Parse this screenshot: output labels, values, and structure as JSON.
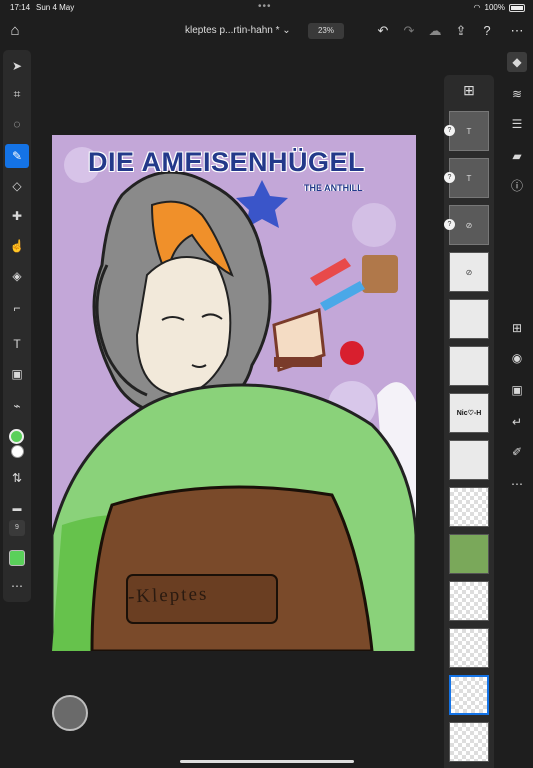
{
  "status": {
    "time": "17:14",
    "date": "Sun 4 May",
    "battery": "100%"
  },
  "header": {
    "title": "kleptes p...rtin-hahn *",
    "zoom": "23%",
    "icons": [
      "home-icon",
      "undo-icon",
      "redo-icon",
      "cloud-icon",
      "share-icon",
      "help-icon",
      "more-icon"
    ]
  },
  "tools": {
    "items": [
      "select",
      "transform",
      "lasso",
      "brush",
      "eraser",
      "healing",
      "smudge",
      "fill",
      "crop",
      "type",
      "image",
      "eyedropper"
    ],
    "active": "brush",
    "primary_color": "#5ad05a",
    "secondary_color": "#ffffff",
    "brush_size": "9"
  },
  "canvas": {
    "title_text": "DIE AMEISENHÜGEL",
    "subtitle_text": "THE ANTHILL",
    "label_text": "-Kleptes"
  },
  "layers": {
    "items": [
      {
        "kind": "text",
        "label": "T"
      },
      {
        "kind": "text",
        "label": "T"
      },
      {
        "kind": "hidden",
        "label": ""
      },
      {
        "kind": "hidden",
        "label": ""
      },
      {
        "kind": "image",
        "label": ""
      },
      {
        "kind": "image",
        "label": ""
      },
      {
        "kind": "image",
        "label": "Nic♡-H"
      },
      {
        "kind": "image",
        "label": ""
      },
      {
        "kind": "image",
        "label": ""
      },
      {
        "kind": "image",
        "label": ""
      },
      {
        "kind": "image",
        "label": ""
      },
      {
        "kind": "image",
        "label": ""
      },
      {
        "kind": "image",
        "label": ""
      },
      {
        "kind": "image",
        "label": ""
      }
    ],
    "selected_index": 12
  },
  "right_rail": [
    "layers-icon",
    "layer-stack-icon",
    "adjustments-icon",
    "comments-icon",
    "info-icon",
    "add-layer-icon",
    "visibility-icon",
    "mask-icon",
    "clip-icon",
    "brush-settings-icon",
    "more-icon"
  ]
}
